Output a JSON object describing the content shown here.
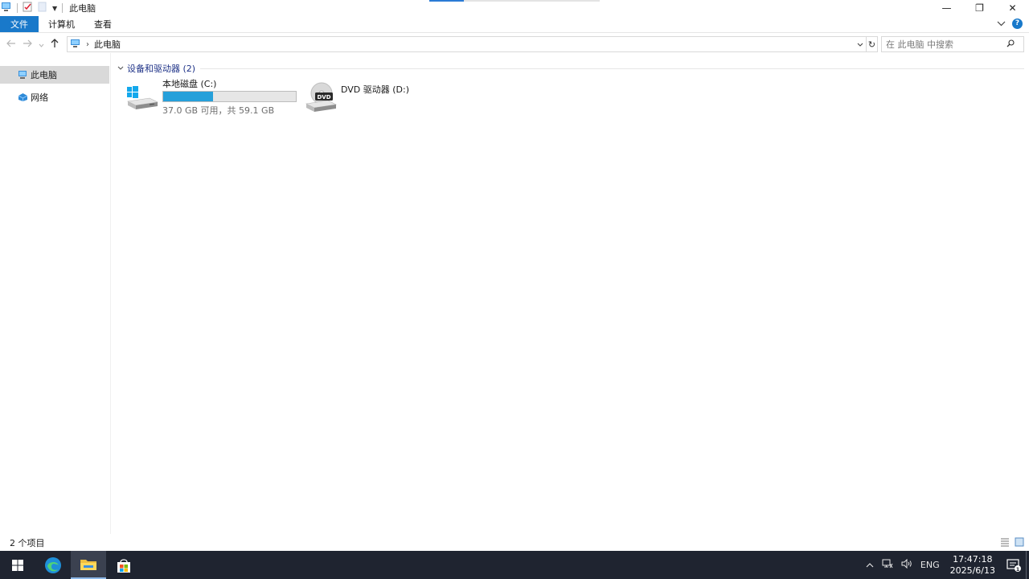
{
  "window": {
    "title": "此电脑",
    "controls": {
      "minimize": "—",
      "restore": "❐",
      "close": "✕"
    }
  },
  "ribbon": {
    "tabs": [
      {
        "label": "文件"
      },
      {
        "label": "计算机"
      },
      {
        "label": "查看"
      }
    ],
    "help": "?"
  },
  "address": {
    "breadcrumb": "此电脑",
    "search_placeholder": "在 此电脑 中搜索"
  },
  "nav_pane": {
    "items": [
      {
        "label": "此电脑",
        "selected": true
      },
      {
        "label": "网络",
        "selected": false
      }
    ]
  },
  "content": {
    "group_header": "设备和驱动器 (2)",
    "drives": [
      {
        "name": "本地磁盘 (C:)",
        "space_text": "37.0 GB 可用，共 59.1 GB",
        "used_fraction": 0.374,
        "bar_color": "#26a0da"
      },
      {
        "name": "DVD 驱动器 (D:)",
        "badge": "DVD"
      }
    ]
  },
  "status_bar": {
    "item_count": "2 个项目"
  },
  "taskbar": {
    "tray": {
      "language": "ENG",
      "time": "17:47:18",
      "date": "2025/6/13",
      "notification_count": "1"
    }
  },
  "colors": {
    "accent": "#1979ca",
    "selection": "#d9d9d9",
    "group_header": "#1e3287",
    "taskbar": "#1f2430"
  }
}
